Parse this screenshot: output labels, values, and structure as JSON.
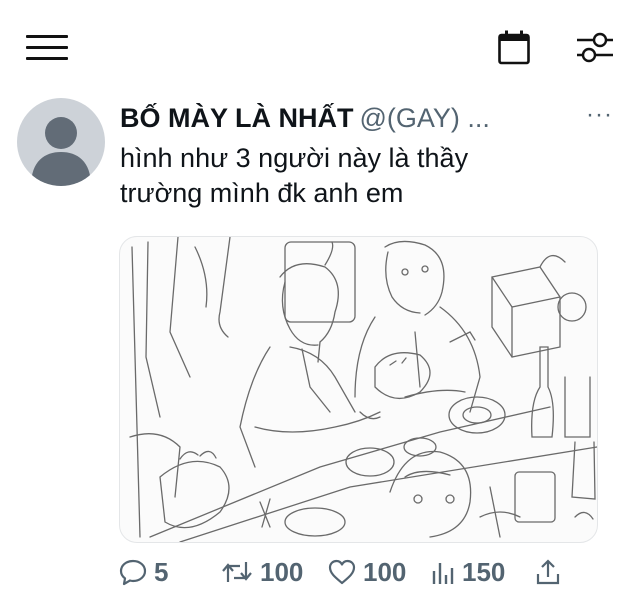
{
  "topbar": {
    "menu_icon": "hamburger-menu-icon",
    "calendar_icon": "calendar-icon",
    "filter_icon": "sliders-icon"
  },
  "tweet": {
    "display_name": "BỐ MÀY LÀ NHẤT",
    "handle": "@(GAY) ...",
    "more_label": "···",
    "text_line1": "hình như 3 người này là thầy",
    "text_line2": "trường mình đk anh em",
    "media": {
      "type": "line-art sketch illustration"
    },
    "actions": {
      "reply_count": "5",
      "retweet_count": "100",
      "like_count": "100",
      "views_count": "150",
      "share_icon": "share-icon"
    }
  },
  "colors": {
    "text_primary": "#0f1419",
    "text_secondary": "#536471",
    "avatar_bg": "#cdd2d8",
    "avatar_fg": "#626c77"
  }
}
